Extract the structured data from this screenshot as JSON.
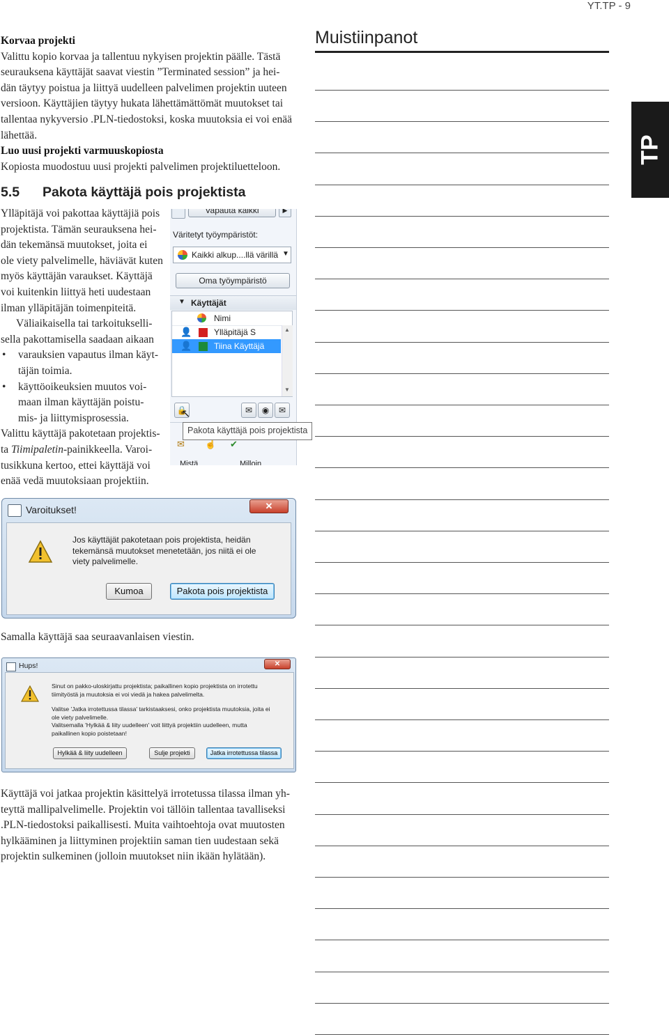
{
  "header": {
    "page_code": "YT.TP - 9"
  },
  "side_tab": {
    "label": "TP"
  },
  "notes": {
    "title": "Muistiinpanot"
  },
  "section_replace": {
    "heading": "Korvaa projekti",
    "lines": [
      "Valittu kopio korvaa ja tallentuu nykyisen projektin päälle. Tästä",
      "seurauksena käyttäjät saavat viestin ”Terminated session” ja hei-",
      "dän täytyy poistua ja liittyä uudelleen palvelimen projektin uuteen",
      "versioon. Käyttäjien täytyy hukata lähettämättömät muutokset tai",
      "tallentaa nykyversio .PLN-tiedostoksi, koska muutoksia ei voi enää",
      "lähettää."
    ]
  },
  "section_backup": {
    "heading": "Luo uusi projekti varmuuskopiosta",
    "line": "Kopiosta muodostuu uusi projekti palvelimen projektiluetteloon."
  },
  "section_55": {
    "number": "5.5",
    "title": "Pakota käyttäjä pois projektista",
    "lines": [
      "Ylläpitäjä voi pakottaa käyttäjiä pois",
      "projektista. Tämän seurauksena hei-",
      "dän tekemänsä muutokset, joita ei",
      "ole viety palvelimelle, häviävät kuten",
      "myös käyttäjän varaukset. Käyttäjä",
      "voi kuitenkin liittyä heti uudestaan",
      "ilman ylläpitäjän toimenpiteitä.",
      "Väliaikaisella tai tarkoitukselli-",
      "sella pakottamisella saadaan aikaan"
    ],
    "bullet1": [
      "varauksien vapautus ilman käyt-",
      "täjän toimia."
    ],
    "bullet2": [
      "käyttöoikeuksien muutos voi-",
      "maan ilman käyttäjän poistu-",
      "mis- ja liittymisprosessia."
    ],
    "after_line1": "Valittu käyttäjä pakotetaan projektis-",
    "after_line2_pre": "ta ",
    "after_line2_em": "Tiimipaletin",
    "after_line2_post": "-painikkeella. Varoi-",
    "after_line3": "tusikkuna kertoo, ettei käyttäjä voi",
    "after_line4": "enää vedä muutoksiaan projektiin."
  },
  "panel": {
    "top_button": "Vapauta kaikki",
    "label_workspaces": "Väritetyt työympäristöt:",
    "combo_value": "Kaikki alkup....llä värillä",
    "own_button": "Oma työympäristö",
    "users_header": "Käyttäjät",
    "col_name": "Nimi",
    "users": [
      "Ylläpitäjä S",
      "Tiina Käyttäjä"
    ],
    "user_colors": [
      "#d32020",
      "#1c8a3a"
    ],
    "tooltip": "Pakota käyttäjä pois projektista",
    "bottom_cols": [
      "Mistä",
      "Milloin"
    ]
  },
  "dialog_warning": {
    "title": "Varoitukset!",
    "message_lines": [
      "Jos käyttäjät pakotetaan pois projektista, heidän",
      "tekemänsä muutokset menetetään, jos niitä ei ole",
      "viety palvelimelle."
    ],
    "cancel": "Kumoa",
    "confirm": "Pakota pois projektista"
  },
  "caption_mid": "Samalla käyttäjä saa seuraavanlaisen viestin.",
  "dialog_hups": {
    "title": "Hups!",
    "lines1": [
      "Sinut on pakko-uloskirjattu projektista; paikallinen kopio projektista on irrotettu",
      "tiimityöstä ja muutoksia ei voi viedä ja hakea palvelimelta."
    ],
    "lines2": [
      "Valitse 'Jatka irrotettussa tilassa' tarkistaaksesi, onko projektista muutoksia, joita ei",
      "ole viety palvelimelle.",
      "Valitsemalla 'Hylkää & liity uudelleen' voit liittyä projektiin uudelleen, mutta",
      "paikallinen kopio poistetaan!"
    ],
    "btn_rejoin": "Hylkää & liity uudelleen",
    "btn_close": "Sulje projekti",
    "btn_continue": "Jatka irrotettussa tilassa"
  },
  "final_paragraph": [
    "Käyttäjä voi jatkaa projektin käsittelyä irrotetussa tilassa ilman yh-",
    "teyttä mallipalvelimelle. Projektin voi tällöin tallentaa tavalliseksi",
    ".PLN-tiedostoksi paikallisesti. Muita vaihtoehtoja ovat muutosten",
    "hylkääminen ja liittyminen projektiin saman tien uudestaan sekä",
    "projektin sulkeminen (jolloin muutokset niin ikään hylätään)."
  ]
}
